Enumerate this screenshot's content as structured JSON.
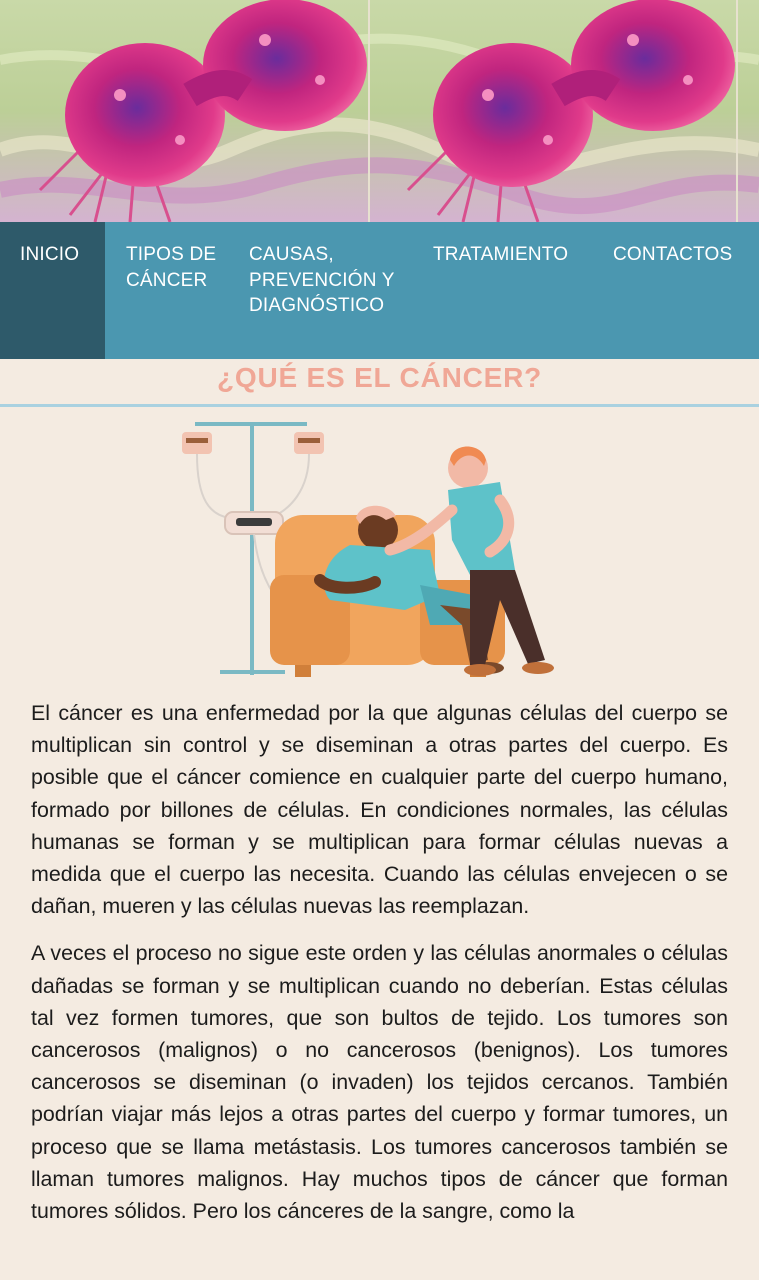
{
  "hero": {
    "image_alt": "cancer cell dividing",
    "icon": "cancer-cell-image"
  },
  "nav": {
    "items": [
      {
        "label": "INICIO",
        "active": true
      },
      {
        "label": "TIPOS DE CÁNCER"
      },
      {
        "label": "CAUSAS, PREVENCIÓN Y DIAGNÓSTICO"
      },
      {
        "label": "TRATAMIENTO"
      },
      {
        "label": "CONTACTOS"
      }
    ]
  },
  "section": {
    "title": "¿QUÉ ES EL CÁNCER?"
  },
  "illustration": {
    "icon": "chemotherapy-patient-illustration"
  },
  "paragraphs": [
    "El cáncer es una enfermedad por la que algunas células del cuerpo se multiplican sin control y se diseminan a otras partes del cuerpo. Es posible que el cáncer comience en cualquier parte del cuerpo humano, formado por billones de células. En condiciones normales, las células humanas se forman y se multiplican para formar células nuevas a medida que el cuerpo las necesita. Cuando las células envejecen o se dañan, mueren y las células nuevas las reemplazan.",
    "A veces el proceso no sigue este orden y las células anormales o células dañadas se forman y se multiplican cuando no deberían. Estas células tal vez formen tumores, que son bultos de tejido. Los tumores son cancerosos (malignos) o no cancerosos (benignos). Los tumores cancerosos se diseminan (o invaden) los tejidos cercanos. También podrían viajar más lejos a otras partes del cuerpo y formar tumores, un proceso que se llama metástasis. Los tumores cancerosos también se llaman tumores malignos. Hay muchos tipos de cáncer que forman tumores sólidos. Pero los cánceres de la sangre, como la"
  ],
  "colors": {
    "nav_bg": "#4b97b0",
    "nav_active": "#2e5a6a",
    "title": "#f0a796",
    "page_bg": "#f4ebe1"
  }
}
